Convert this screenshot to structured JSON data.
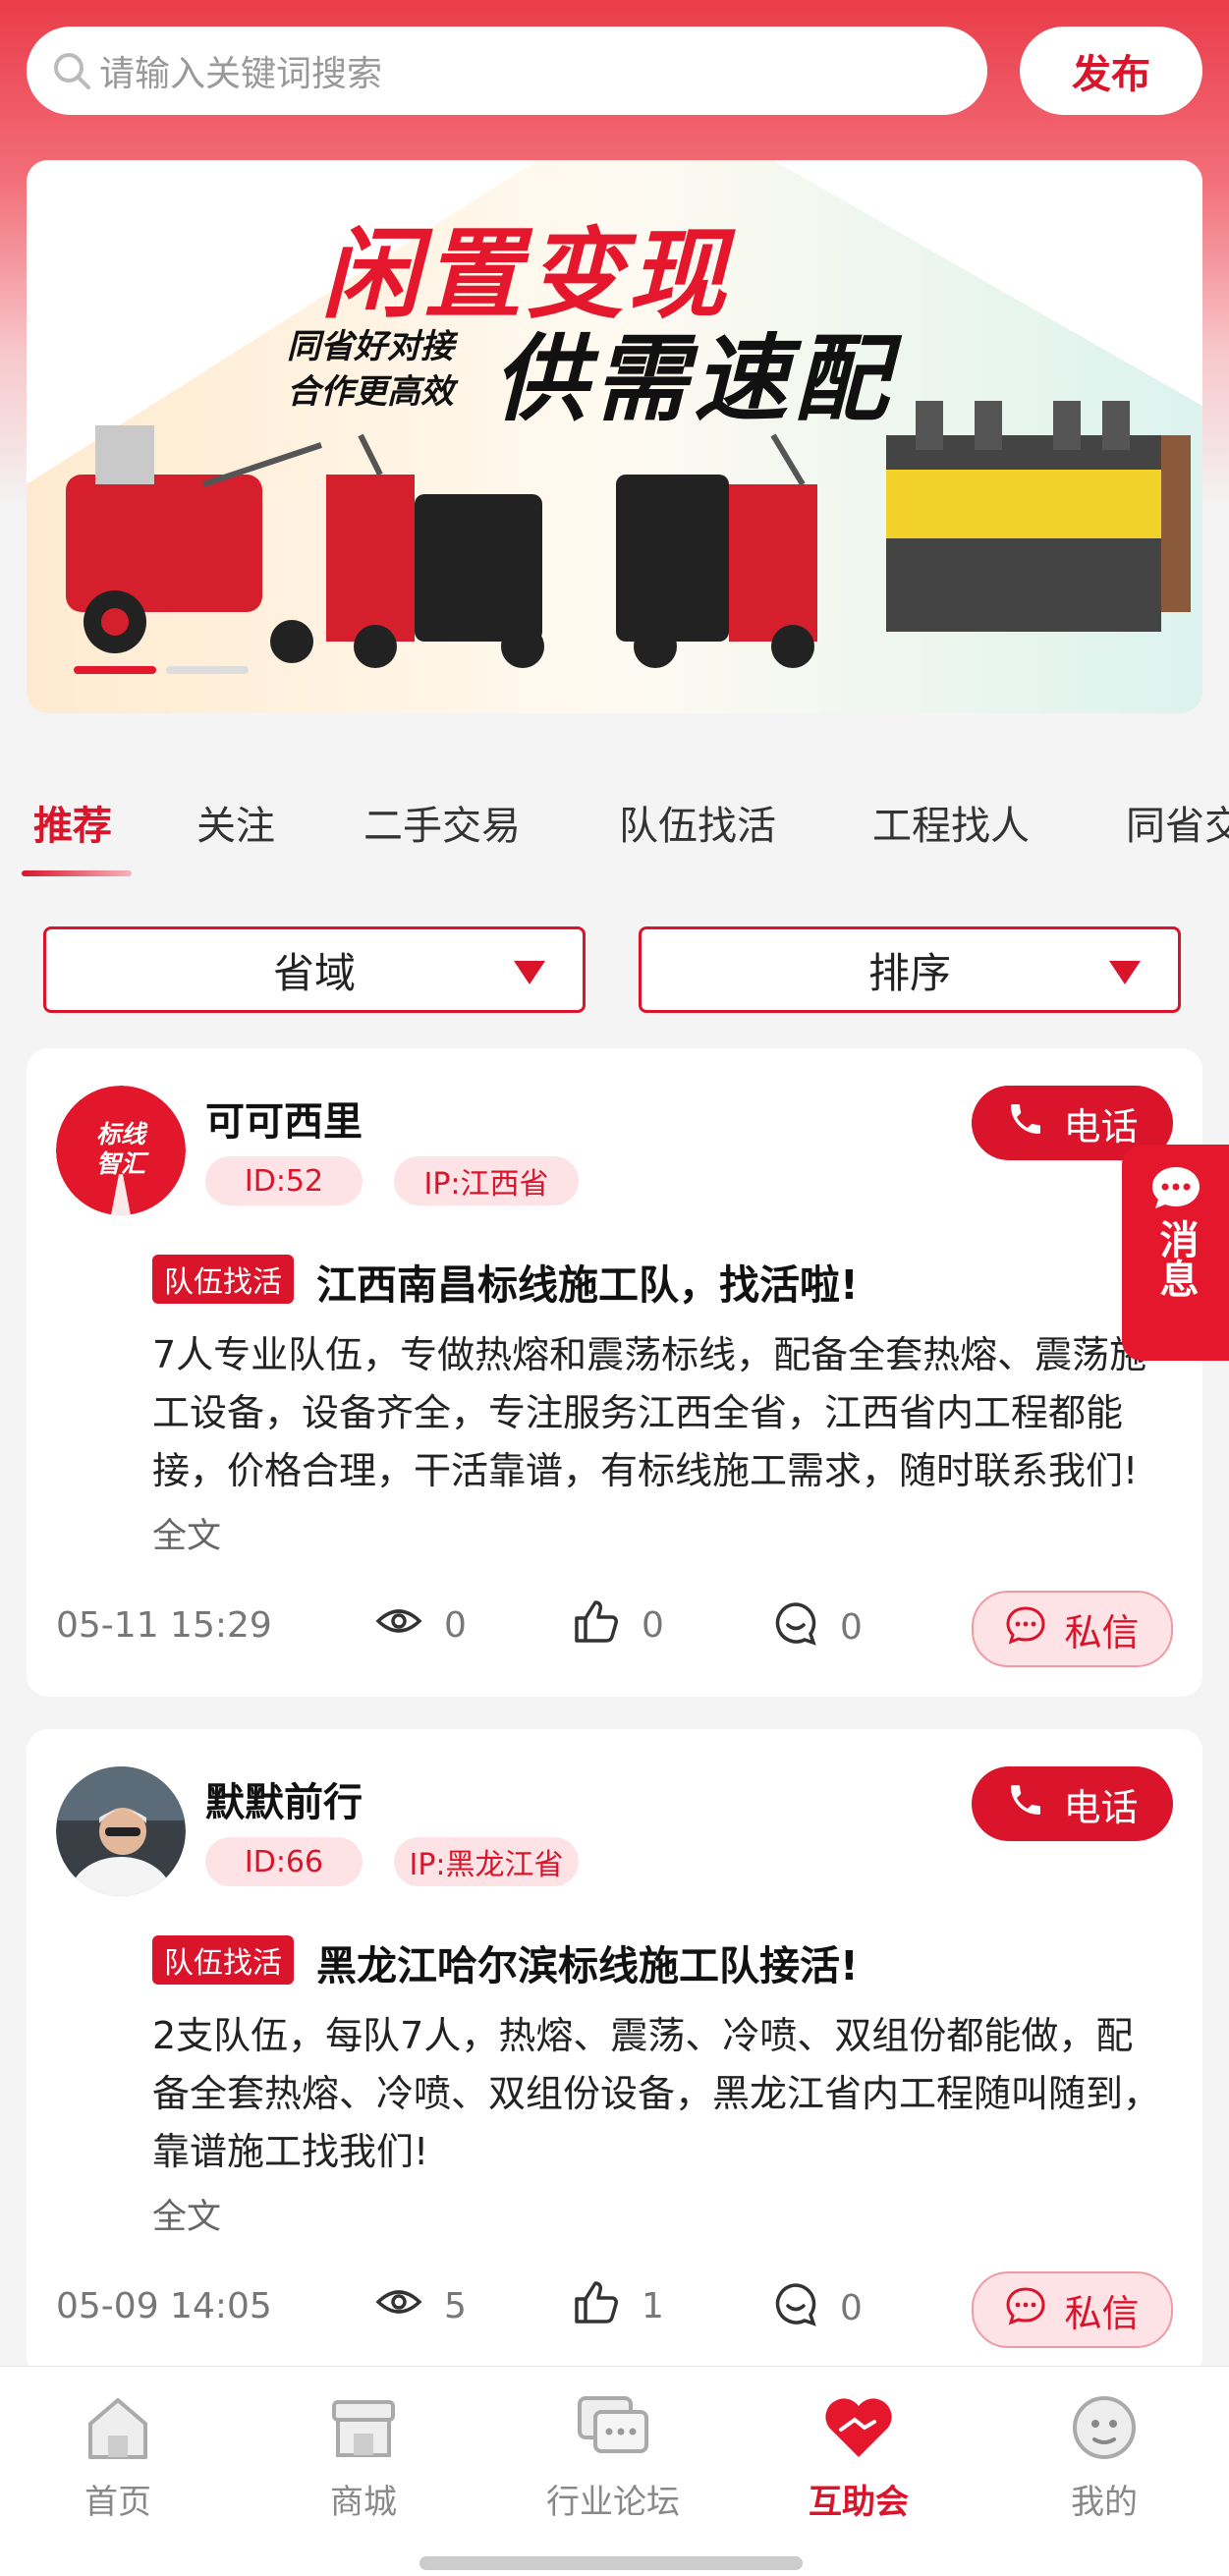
{
  "search": {
    "placeholder": "请输入关键词搜索"
  },
  "header": {
    "publish_label": "发布"
  },
  "banner": {
    "title": "闲置变现",
    "sub1": "同省好对接",
    "sub2": "合作更高效",
    "slogan": "供需速配"
  },
  "tabs": [
    {
      "label": "推荐",
      "active": true
    },
    {
      "label": "关注"
    },
    {
      "label": "二手交易"
    },
    {
      "label": "队伍找活"
    },
    {
      "label": "工程找人"
    },
    {
      "label": "同省交"
    }
  ],
  "filters": {
    "province": "省域",
    "sort": "排序"
  },
  "posts": [
    {
      "username": "可可西里",
      "avatar_text": "标线智汇",
      "id_label": "ID:52",
      "ip_label": "IP:江西省",
      "call_label": "电话",
      "tag": "队伍找活",
      "title": "江西南昌标线施工队，找活啦!",
      "body": "7人专业队伍，专做热熔和震荡标线，配备全套热熔、震荡施工设备，设备齐全，专注服务江西全省，江西省内工程都能接，价格合理，干活靠谱，有标线施工需求，随时联系我们!",
      "full_label": "全文",
      "time": "05-11 15:29",
      "views": "0",
      "likes": "0",
      "comments": "0",
      "dm_label": "私信"
    },
    {
      "username": "默默前行",
      "id_label": "ID:66",
      "ip_label": "IP:黑龙江省",
      "call_label": "电话",
      "tag": "队伍找活",
      "title": "黑龙江哈尔滨标线施工队接活!",
      "body": "2支队伍，每队7人，热熔、震荡、冷喷、双组份都能做，配备全套热熔、冷喷、双组份设备，黑龙江省内工程随叫随到，靠谱施工找我们!",
      "full_label": "全文",
      "time": "05-09 14:05",
      "views": "5",
      "likes": "1",
      "comments": "0",
      "dm_label": "私信"
    }
  ],
  "float_button": {
    "label": "消息"
  },
  "bottom_nav": [
    {
      "label": "首页",
      "icon": "home-icon"
    },
    {
      "label": "商城",
      "icon": "store-icon"
    },
    {
      "label": "行业论坛",
      "icon": "forum-icon"
    },
    {
      "label": "互助会",
      "icon": "handshake-heart-icon",
      "active": true
    },
    {
      "label": "我的",
      "icon": "profile-icon"
    }
  ],
  "colors": {
    "accent": "#d9142b",
    "accent_light": "#fde3e5"
  }
}
